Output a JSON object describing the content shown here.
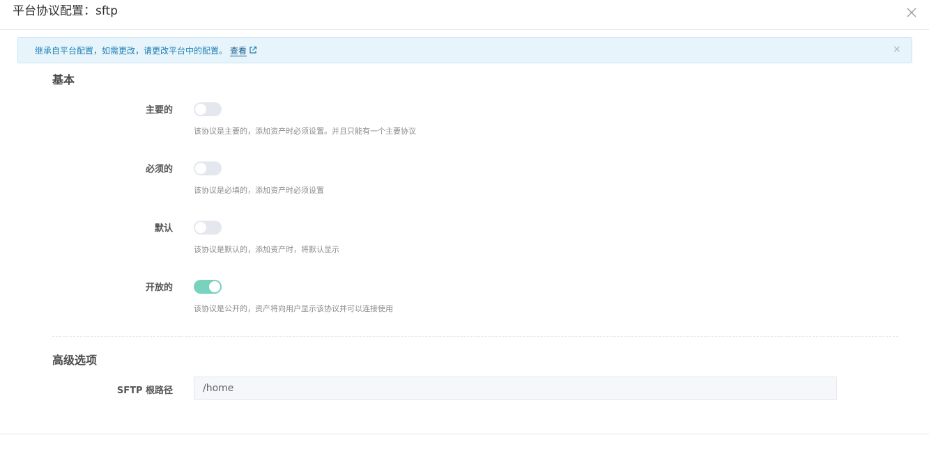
{
  "dialog": {
    "title": "平台协议配置：sftp"
  },
  "alert": {
    "text": "继承自平台配置，如需更改，请更改平台中的配置。",
    "link_label": "查看",
    "close_symbol": "×"
  },
  "sections": {
    "basic_title": "基本",
    "advanced_title": "高级选项"
  },
  "fields": {
    "primary": {
      "label": "主要的",
      "enabled": false,
      "help": "该协议是主要的，添加资产时必须设置。并且只能有一个主要协议"
    },
    "required": {
      "label": "必须的",
      "enabled": false,
      "help": "该协议是必填的，添加资产时必须设置"
    },
    "default": {
      "label": "默认",
      "enabled": false,
      "help": "该协议是默认的，添加资产时，将默认显示"
    },
    "public": {
      "label": "开放的",
      "enabled": true,
      "help": "该协议是公开的，资产将向用户显示该协议并可以连接使用"
    },
    "sftp_root": {
      "label": "SFTP 根路径",
      "value": "/home"
    }
  },
  "colors": {
    "switch_on": "#78d2bd",
    "switch_off": "#e4e7ed",
    "alert_bg": "#e8f4fb",
    "alert_text": "#1a7fb5"
  }
}
